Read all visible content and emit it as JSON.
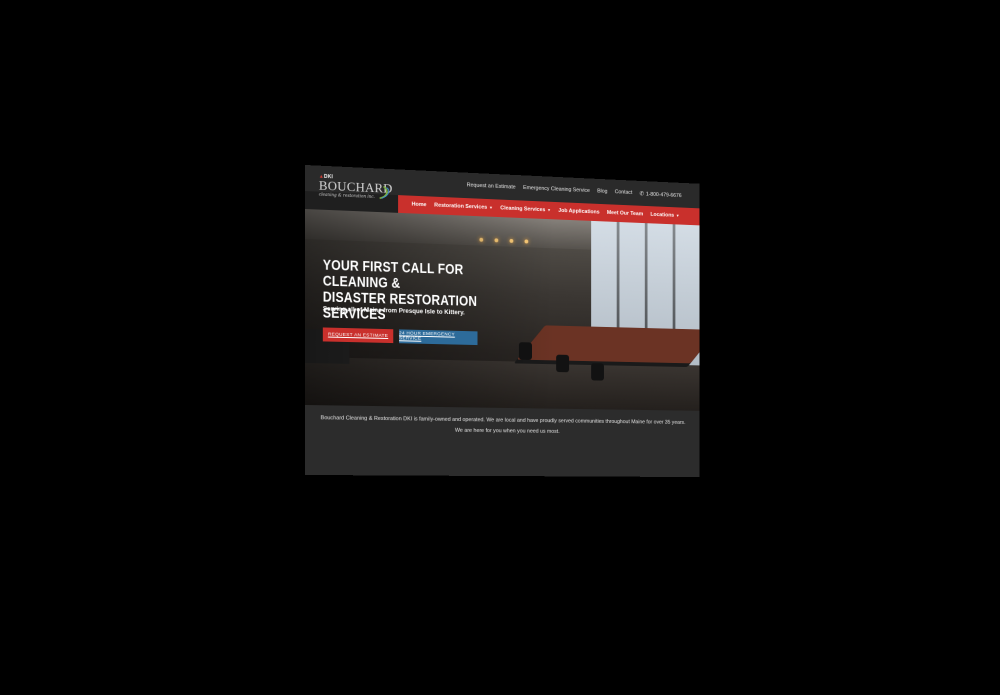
{
  "topnav": {
    "links": [
      "Request an Estimate",
      "Emergency Cleaning Service",
      "Blog",
      "Contact"
    ],
    "phone": "1-800-479-6676"
  },
  "logo": {
    "dki": "DKI",
    "brand": "BOUCHARD",
    "tagline": "cleaning & restoration inc."
  },
  "mainnav": {
    "items": [
      {
        "label": "Home",
        "dropdown": false
      },
      {
        "label": "Restoration Services",
        "dropdown": true
      },
      {
        "label": "Cleaning Services",
        "dropdown": true
      },
      {
        "label": "Job Applications",
        "dropdown": false
      },
      {
        "label": "Meet Our Team",
        "dropdown": false
      },
      {
        "label": "Locations",
        "dropdown": true
      }
    ]
  },
  "hero": {
    "title_line1": "YOUR FIRST CALL FOR CLEANING &",
    "title_line2": "DISASTER RESTORATION SERVICES",
    "subtitle": "Serving all of Maine from Presque Isle to Kittery.",
    "cta_primary": "REQUEST AN ESTIMATE",
    "cta_secondary": "24 HOUR EMERGENCY SERVICE"
  },
  "intro": {
    "text": "Bouchard Cleaning & Restoration DKI is family-owned and operated. We are local and have proudly served communities throughout Maine for over 35 years. We are here for you when you need us most."
  },
  "colors": {
    "accent_red": "#c9302c",
    "accent_blue": "#2d6b9a",
    "dark_bg": "#2a2a2a"
  },
  "icons": [
    "phone-icon",
    "caret-down-icon",
    "logo-swirl-icon"
  ]
}
